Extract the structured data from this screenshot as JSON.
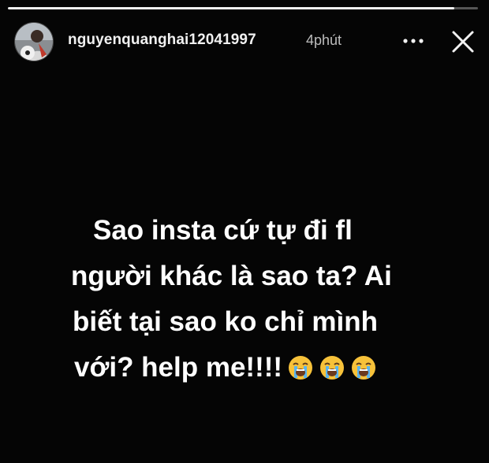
{
  "story": {
    "progress": 0.95,
    "progress_color": "#f2f2f2",
    "header": {
      "username": "nguyenquanghai12041997",
      "timestamp": "4phút",
      "more_icon": "more-horizontal-icon",
      "close_icon": "close-icon"
    },
    "caption": {
      "lines": [
        "Sao insta cứ tự đi fl",
        "người khác là sao ta? Ai",
        "biết tại sao ko chỉ mình",
        "với? help me!!!!"
      ],
      "emojis": [
        "loudly-crying-face-icon",
        "loudly-crying-face-icon",
        "loudly-crying-face-icon"
      ]
    },
    "background_color": "#050505"
  }
}
